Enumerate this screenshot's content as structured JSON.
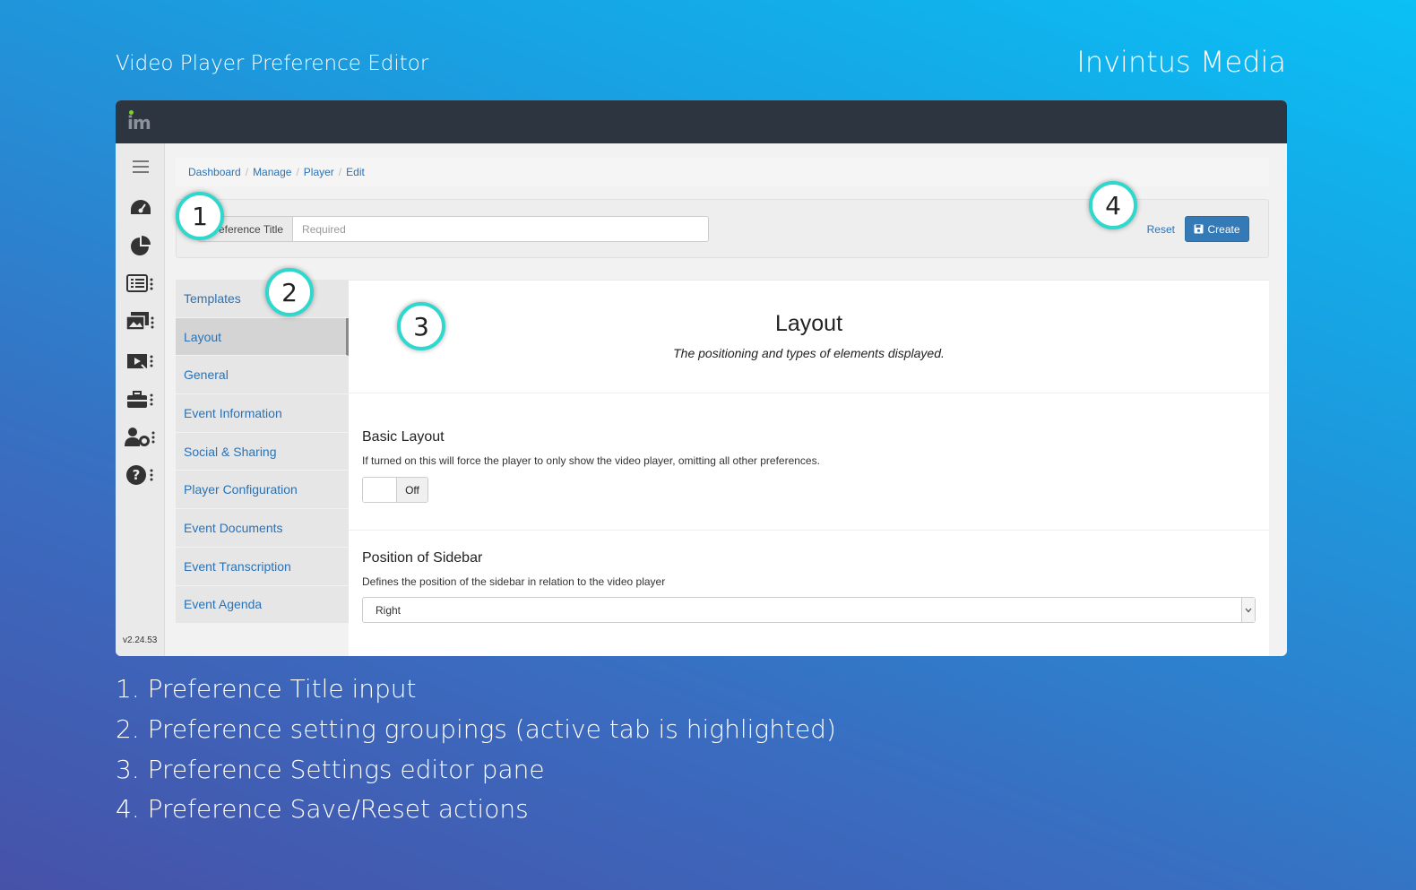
{
  "header": {
    "title": "Video Player Preference Editor",
    "brand": "Invintus Media"
  },
  "app": {
    "logo_text": "im",
    "version": "v2.24.53",
    "breadcrumbs": [
      "Dashboard",
      "Manage",
      "Player",
      "Edit"
    ],
    "title_field": {
      "label": "Preference Title",
      "placeholder": "Required",
      "value": ""
    },
    "actions": {
      "reset_label": "Reset",
      "create_label": "Create"
    },
    "groups": [
      {
        "label": "Templates",
        "active": false
      },
      {
        "label": "Layout",
        "active": true
      },
      {
        "label": "General",
        "active": false
      },
      {
        "label": "Event Information",
        "active": false
      },
      {
        "label": "Social & Sharing",
        "active": false
      },
      {
        "label": "Player Configuration",
        "active": false
      },
      {
        "label": "Event Documents",
        "active": false
      },
      {
        "label": "Event Transcription",
        "active": false
      },
      {
        "label": "Event Agenda",
        "active": false
      }
    ],
    "pane": {
      "title": "Layout",
      "subtitle": "The positioning and types of elements displayed.",
      "basic_layout": {
        "title": "Basic Layout",
        "description": "If turned on this will force the player to only show the video player, omitting all other preferences.",
        "toggle_state": "Off"
      },
      "sidebar_position": {
        "title": "Position of Sidebar",
        "description": "Defines the position of the sidebar in relation to the video player",
        "selected": "Right"
      }
    },
    "rail_icons": [
      "menu-icon",
      "dashboard-gauge-icon",
      "pie-chart-icon",
      "list-icon",
      "media-library-icon",
      "video-publish-icon",
      "toolbox-icon",
      "user-settings-icon",
      "help-icon"
    ]
  },
  "callouts": [
    "1",
    "2",
    "3",
    "4"
  ],
  "legend": [
    "1. Preference Title input",
    "2. Preference setting groupings (active tab is highlighted)",
    "3. Preference Settings editor pane",
    "4. Preference Save/Reset actions"
  ],
  "colors": {
    "accent": "#337ab7",
    "link": "#2a72b5",
    "callout_ring": "#2ed8cc",
    "topbar": "#2d3640"
  }
}
